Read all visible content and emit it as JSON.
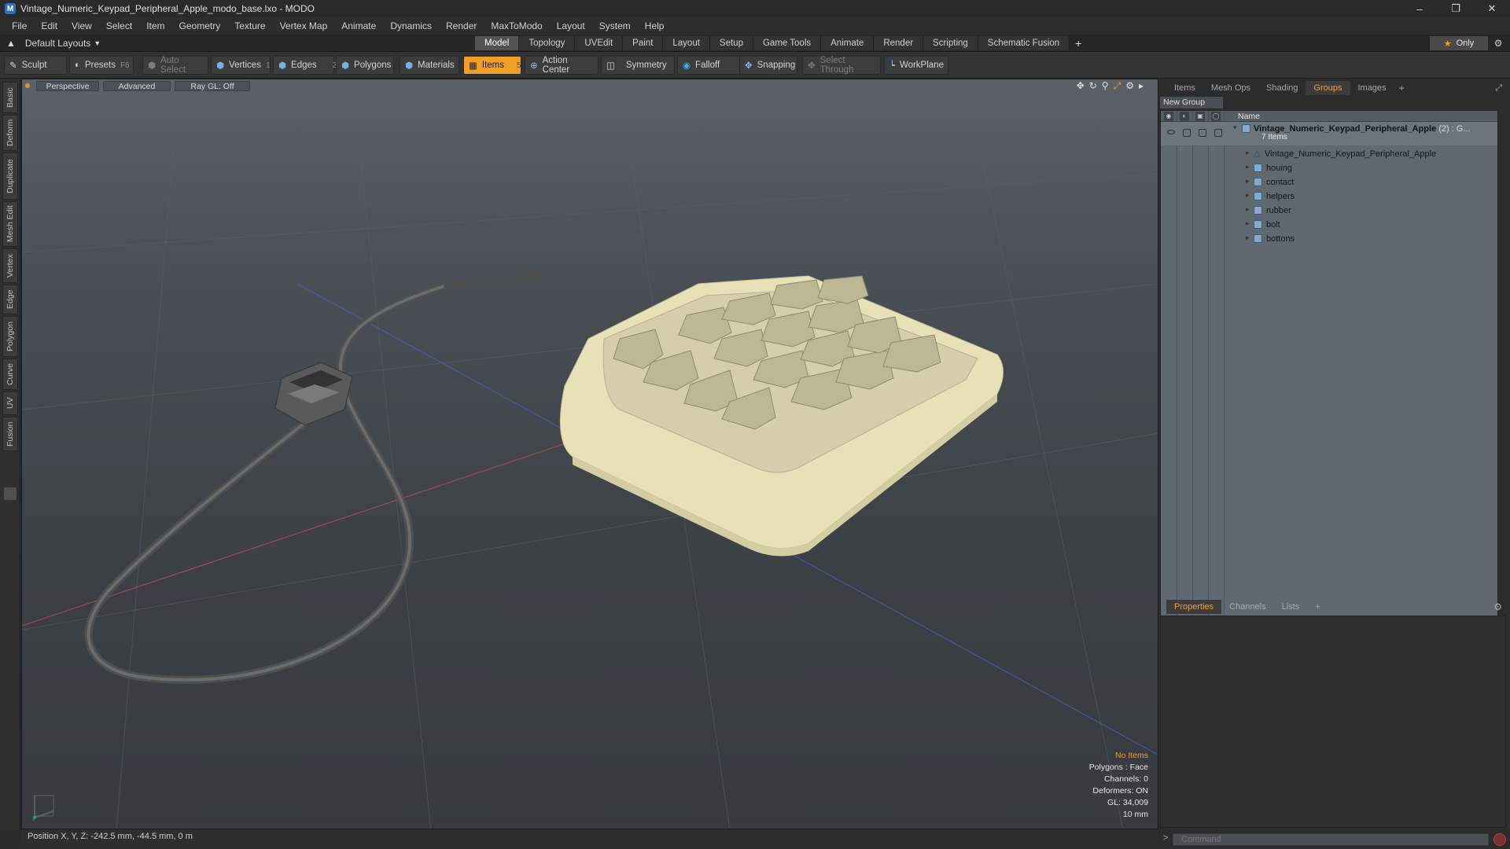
{
  "window": {
    "title": "Vintage_Numeric_Keypad_Peripheral_Apple_modo_base.lxo - MODO",
    "app_icon": "modo-logo-icon",
    "controls": [
      "minimize-icon",
      "restore-icon",
      "close-icon"
    ]
  },
  "menu": [
    "File",
    "Edit",
    "View",
    "Select",
    "Item",
    "Geometry",
    "Texture",
    "Vertex Map",
    "Animate",
    "Dynamics",
    "Render",
    "MaxToModo",
    "Layout",
    "System",
    "Help"
  ],
  "layouts": {
    "selector": "Default Layouts",
    "tabs": [
      "Model",
      "Topology",
      "UVEdit",
      "Paint",
      "Layout",
      "Setup",
      "Game Tools",
      "Animate",
      "Render",
      "Scripting",
      "Schematic Fusion"
    ],
    "active_tab": "Model",
    "only_label": "Only"
  },
  "toolbar": {
    "sculpt": "Sculpt",
    "presets": "Presets",
    "presets_key": "F6",
    "auto_select": "Auto Select",
    "vertices": "Vertices",
    "vertices_key": "1",
    "edges": "Edges",
    "edges_key": "2",
    "polygons": "Polygons",
    "materials": "Materials",
    "items": "Items",
    "items_key": "5",
    "action_center": "Action Center",
    "symmetry": "Symmetry",
    "falloff": "Falloff",
    "snapping": "Snapping",
    "select_through": "Select Through",
    "workplane": "WorkPlane"
  },
  "left_tabs": [
    "Basic",
    "Deform",
    "Duplicate",
    "Mesh Edit",
    "Vertex",
    "Edge",
    "Polygon",
    "Curve",
    "UV",
    "Fusion"
  ],
  "viewport": {
    "view_mode": "Perspective",
    "shading": "Advanced",
    "raygl": "Ray GL: Off",
    "info": {
      "selection": "No Items",
      "polygons": "Polygons : Face",
      "channels": "Channels: 0",
      "deformers": "Deformers: ON",
      "gl": "GL: 34,009",
      "scale": "10 mm"
    }
  },
  "status_bar": {
    "position": "Position X, Y, Z:  -242.5 mm, -44.5 mm, 0 m"
  },
  "right_panel": {
    "tabs": [
      "Items",
      "Mesh Ops",
      "Shading",
      "Groups",
      "Images"
    ],
    "active_tab": "Groups",
    "new_group": "New Group",
    "name_header": "Name",
    "group": {
      "name": "Vintage_Numeric_Keypad_Peripheral_Apple",
      "count": "(2) : G...",
      "subtitle": "7 Items"
    },
    "items": [
      "Vintage_Numeric_Keypad_Peripheral_Apple",
      "houing",
      "contact",
      "helpers",
      "rubber",
      "bolt",
      "bottons"
    ],
    "bottom_tabs": [
      "Properties",
      "Channels",
      "Lists"
    ],
    "bottom_active": "Properties",
    "command_placeholder": "Command"
  },
  "colors": {
    "accent": "#f0a030",
    "viewport_top": "#5b6167",
    "viewport_bottom": "#373b40",
    "tree_bg": "#606871"
  }
}
